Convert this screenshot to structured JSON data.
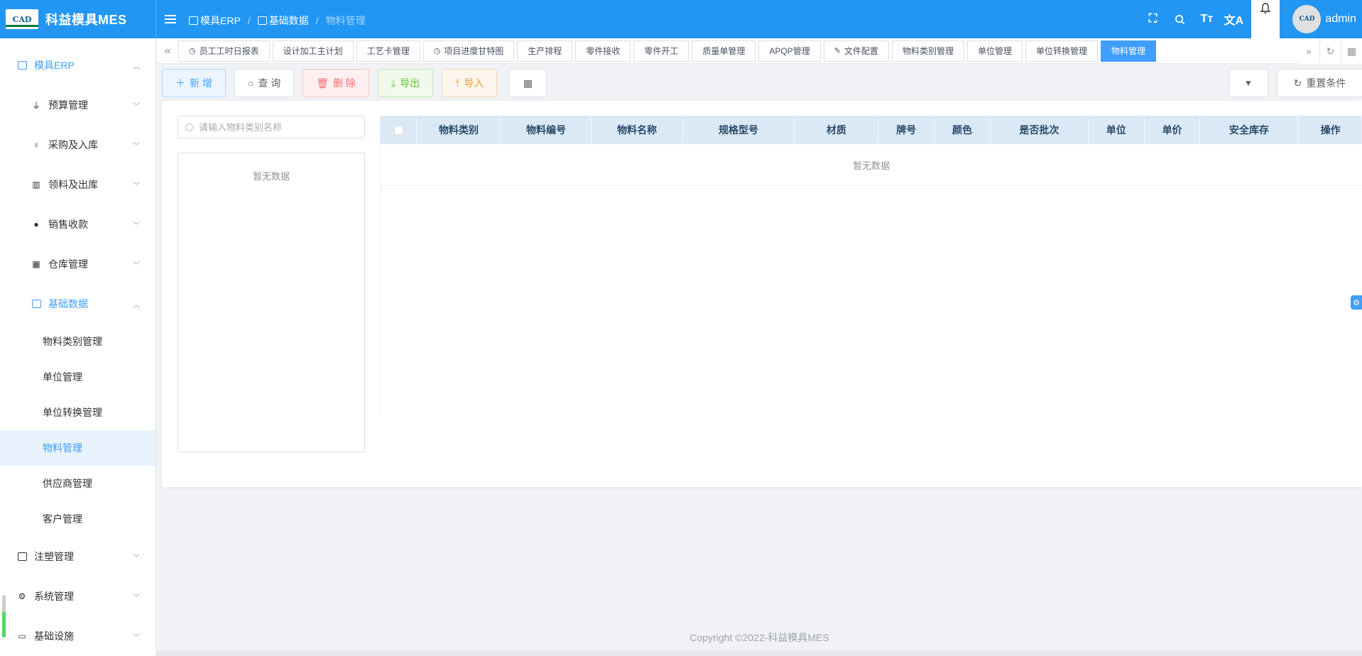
{
  "app": {
    "title": "科益模具MES",
    "logo_text": "CAD"
  },
  "header": {
    "breadcrumb": [
      "模具ERP",
      "基础数据",
      "物料管理"
    ],
    "user": {
      "name": "admin",
      "avatar_text": "CAD"
    }
  },
  "sidebar": {
    "root": {
      "label": "模具ERP"
    },
    "groups": [
      {
        "label": "预算管理",
        "icon": "funnel-icon"
      },
      {
        "label": "采购及入库",
        "icon": "bike-icon"
      },
      {
        "label": "领料及出库",
        "icon": "building-icon"
      },
      {
        "label": "销售收款",
        "icon": "person-icon"
      },
      {
        "label": "仓库管理",
        "icon": "calendar-icon"
      }
    ],
    "basic": {
      "label": "基础数据",
      "children": [
        "物料类别管理",
        "单位管理",
        "单位转换管理",
        "物料管理",
        "供应商管理",
        "客户管理"
      ]
    },
    "bottom": [
      {
        "label": "注塑管理"
      },
      {
        "label": "系统管理"
      },
      {
        "label": "基础设施"
      }
    ]
  },
  "tabs": [
    {
      "label": "员工工时日报表",
      "icon": "clock"
    },
    {
      "label": "设计加工主计划"
    },
    {
      "label": "工艺卡管理"
    },
    {
      "label": "项目进度甘特图",
      "icon": "clock"
    },
    {
      "label": "生产排程"
    },
    {
      "label": "零件接收"
    },
    {
      "label": "零件开工"
    },
    {
      "label": "质量单管理"
    },
    {
      "label": "APQP管理"
    },
    {
      "label": "文件配置",
      "icon": "doc"
    },
    {
      "label": "物料类别管理"
    },
    {
      "label": "单位管理"
    },
    {
      "label": "单位转换管理"
    },
    {
      "label": "物料管理",
      "active": true
    }
  ],
  "toolbar": {
    "add": "新 增",
    "query": "查 询",
    "delete": "删 除",
    "export": "导出",
    "import": "导入",
    "reset": "重置条件"
  },
  "left_panel": {
    "search_placeholder": "请输入物料类别名称",
    "empty_text": "暂无数据"
  },
  "table": {
    "columns": [
      "物料类别",
      "物料编号",
      "物料名称",
      "规格型号",
      "材质",
      "牌号",
      "颜色",
      "是否批次",
      "单位",
      "单价",
      "安全库存",
      "操作"
    ],
    "empty_text": "暂无数据"
  },
  "footer": {
    "copyright": "Copyright ©2022-科益模具MES"
  },
  "colors": {
    "primary": "#2196f3",
    "accent": "#409eff"
  }
}
